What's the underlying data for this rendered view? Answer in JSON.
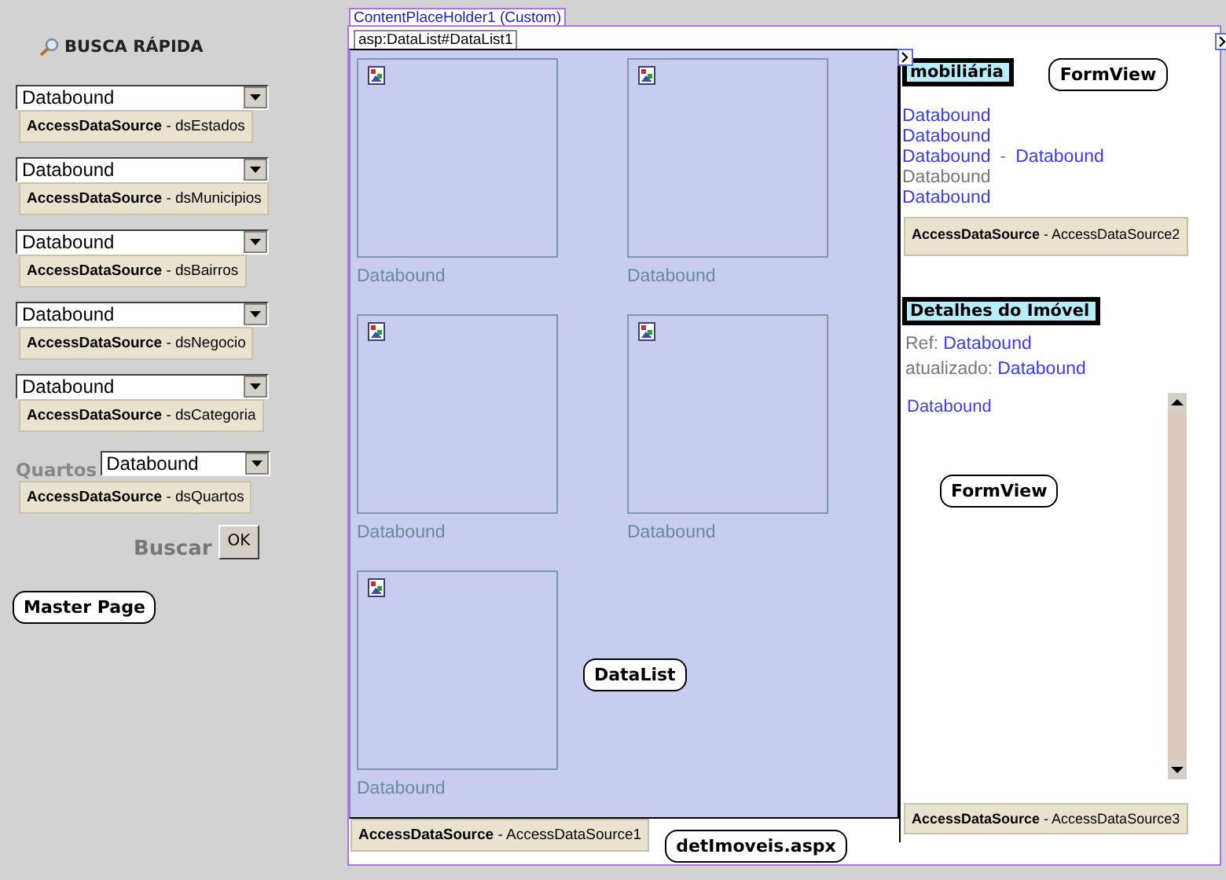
{
  "sidebar": {
    "title": "BUSCA RÁPIDA",
    "filters": [
      {
        "value": "Databound",
        "source": {
          "type": "AccessDataSource",
          "separator": "-",
          "name": "dsEstados"
        }
      },
      {
        "value": "Databound",
        "source": {
          "type": "AccessDataSource",
          "separator": "-",
          "name": "dsMunicipios"
        }
      },
      {
        "value": "Databound",
        "source": {
          "type": "AccessDataSource",
          "separator": "-",
          "name": "dsBairros"
        }
      },
      {
        "value": "Databound",
        "source": {
          "type": "AccessDataSource",
          "separator": "-",
          "name": "dsNegocio"
        }
      },
      {
        "value": "Databound",
        "source": {
          "type": "AccessDataSource",
          "separator": "-",
          "name": "dsCategoria"
        }
      },
      {
        "label": "Quartos",
        "value": "Databound",
        "source": {
          "type": "AccessDataSource",
          "separator": "-",
          "name": "dsQuartos"
        }
      }
    ],
    "search_label": "Buscar",
    "ok_button": "OK",
    "master_tag": "Master Page"
  },
  "content": {
    "title": "ContentPlaceHolder1 (Custom)",
    "datalist": {
      "tag": "asp:DataList#DataList1",
      "items": [
        {
          "caption": "Databound"
        },
        {
          "caption": "Databound"
        },
        {
          "caption": "Databound"
        },
        {
          "caption": "Databound"
        },
        {
          "caption": "Databound"
        }
      ],
      "callout": "DataList",
      "source": {
        "type": "AccessDataSource",
        "separator": "-",
        "name": "AccessDataSource1"
      }
    },
    "page_tag": "detImoveis.aspx",
    "detail": {
      "heading": "mobiliária",
      "callout": "FormView",
      "lines": [
        [
          {
            "text": "Databound",
            "kind": "bound"
          }
        ],
        [
          {
            "text": "Databound",
            "kind": "bound"
          }
        ],
        [
          {
            "text": "Databound",
            "kind": "bound"
          },
          {
            "text": "-",
            "kind": "plain"
          },
          {
            "text": "Databound",
            "kind": "bound"
          }
        ],
        [
          {
            "text": "Databound",
            "kind": "plain"
          }
        ],
        [
          {
            "text": "Databound",
            "kind": "bound"
          }
        ]
      ],
      "source": {
        "type": "AccessDataSource",
        "separator": "-",
        "name": "AccessDataSource2"
      }
    },
    "property": {
      "heading": "Detalhes do Imóvel",
      "lines": [
        [
          {
            "text": "Ref:",
            "kind": "plain"
          },
          {
            "text": "Databound",
            "kind": "bound"
          }
        ],
        [
          {
            "text": "atualizado:",
            "kind": "plain"
          },
          {
            "text": "Databound",
            "kind": "bound"
          }
        ]
      ],
      "panel_text": "Databound",
      "callout": "FormView",
      "source": {
        "type": "AccessDataSource",
        "separator": "-",
        "name": "AccessDataSource3"
      }
    }
  }
}
